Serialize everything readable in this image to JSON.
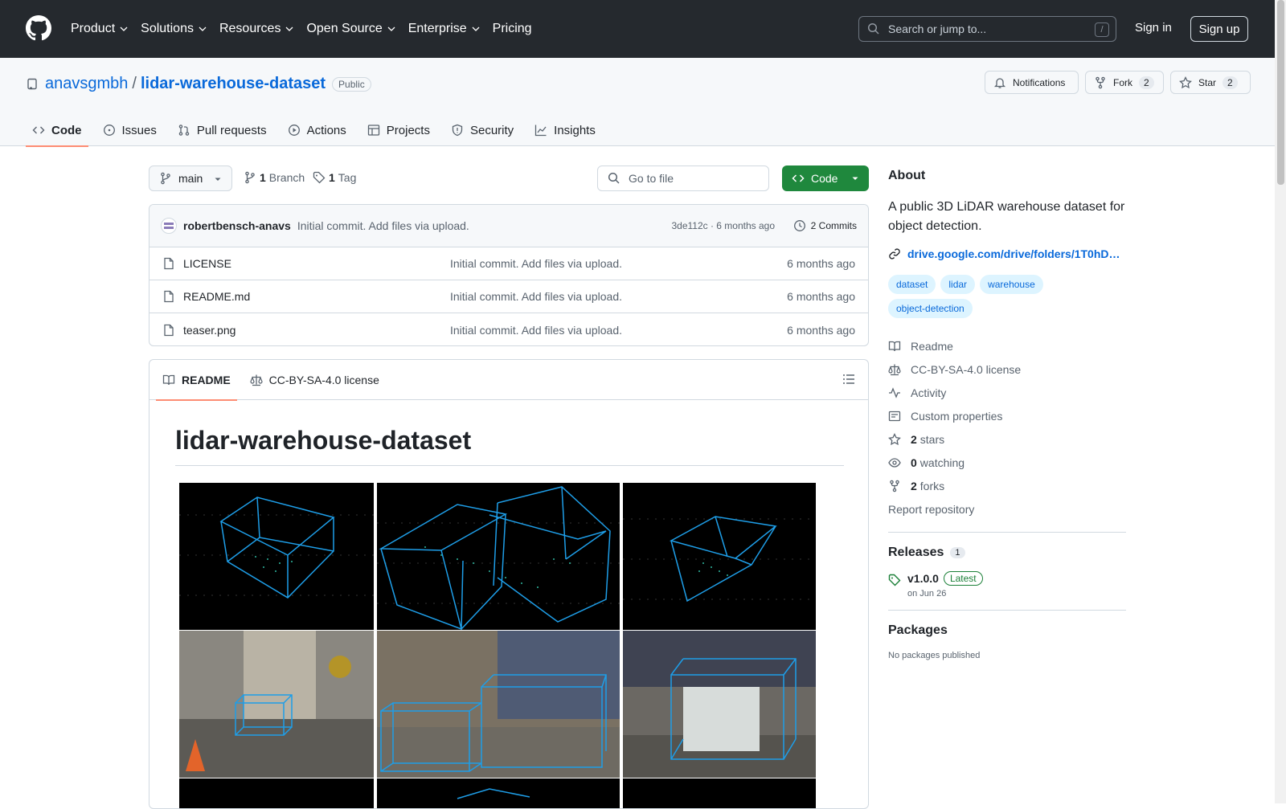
{
  "nav": {
    "items": [
      "Product",
      "Solutions",
      "Resources",
      "Open Source",
      "Enterprise",
      "Pricing"
    ],
    "search_placeholder": "Search or jump to...",
    "search_hint": "/",
    "signin": "Sign in",
    "signup": "Sign up"
  },
  "repo": {
    "owner": "anavsgmbh",
    "separator": "/",
    "name": "lidar-warehouse-dataset",
    "visibility": "Public",
    "notifications_label": "Notifications",
    "fork_label": "Fork",
    "fork_count": "2",
    "star_label": "Star",
    "star_count": "2"
  },
  "tabs": [
    "Code",
    "Issues",
    "Pull requests",
    "Actions",
    "Projects",
    "Security",
    "Insights"
  ],
  "toolbar": {
    "branch": "main",
    "branch_count": "1",
    "branch_label": "Branch",
    "tag_count": "1",
    "tag_label": "Tag",
    "goto_placeholder": "Go to file",
    "code_label": "Code"
  },
  "commit": {
    "author": "robertbensch-anavs",
    "message": "Initial commit. Add files via upload.",
    "hash_time": "3de112c · 6 months ago",
    "commits": "2 Commits"
  },
  "files": [
    {
      "name": "LICENSE",
      "message": "Initial commit. Add files via upload.",
      "age": "6 months ago"
    },
    {
      "name": "README.md",
      "message": "Initial commit. Add files via upload.",
      "age": "6 months ago"
    },
    {
      "name": "teaser.png",
      "message": "Initial commit. Add files via upload.",
      "age": "6 months ago"
    }
  ],
  "readme": {
    "tab_readme": "README",
    "tab_license": "CC-BY-SA-4.0 license",
    "title": "lidar-warehouse-dataset"
  },
  "about": {
    "heading": "About",
    "description": "A public 3D LiDAR warehouse dataset for object detection.",
    "link": "drive.google.com/drive/folders/1T0hD…",
    "topics": [
      "dataset",
      "lidar",
      "warehouse",
      "object-detection"
    ],
    "readme": "Readme",
    "license": "CC-BY-SA-4.0 license",
    "activity": "Activity",
    "custom_properties": "Custom properties",
    "stars_count": "2",
    "stars_label": "stars",
    "watching_count": "0",
    "watching_label": "watching",
    "forks_count": "2",
    "forks_label": "forks",
    "report": "Report repository"
  },
  "releases": {
    "heading": "Releases",
    "count": "1",
    "version": "v1.0.0",
    "latest": "Latest",
    "date": "on Jun 26"
  },
  "packages": {
    "heading": "Packages",
    "empty": "No packages published"
  },
  "colors": {
    "topbar": "#25292e",
    "accent": "#0969da",
    "code_button": "#1f883d",
    "tab_underline": "#fd8c73",
    "box_overlay": "#1e9ee8"
  }
}
